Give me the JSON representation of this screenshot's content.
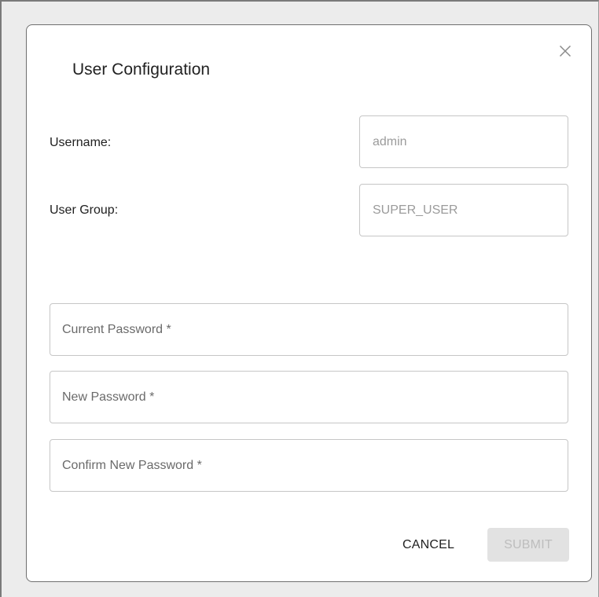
{
  "dialog": {
    "title": "User Configuration",
    "close_icon": "close-icon"
  },
  "info": {
    "username_label": "Username:",
    "username_value": "admin",
    "group_label": "User Group:",
    "group_value": "SUPER_USER"
  },
  "password": {
    "current_label": "Current Password *",
    "new_label": "New Password *",
    "confirm_label": "Confirm New Password *"
  },
  "actions": {
    "cancel_label": "CANCEL",
    "submit_label": "SUBMIT",
    "submit_disabled": true
  },
  "colors": {
    "submit_disabled_bg": "#e2e2e2",
    "submit_disabled_text": "#bdbdbd",
    "field_border": "#c6c6c6"
  }
}
